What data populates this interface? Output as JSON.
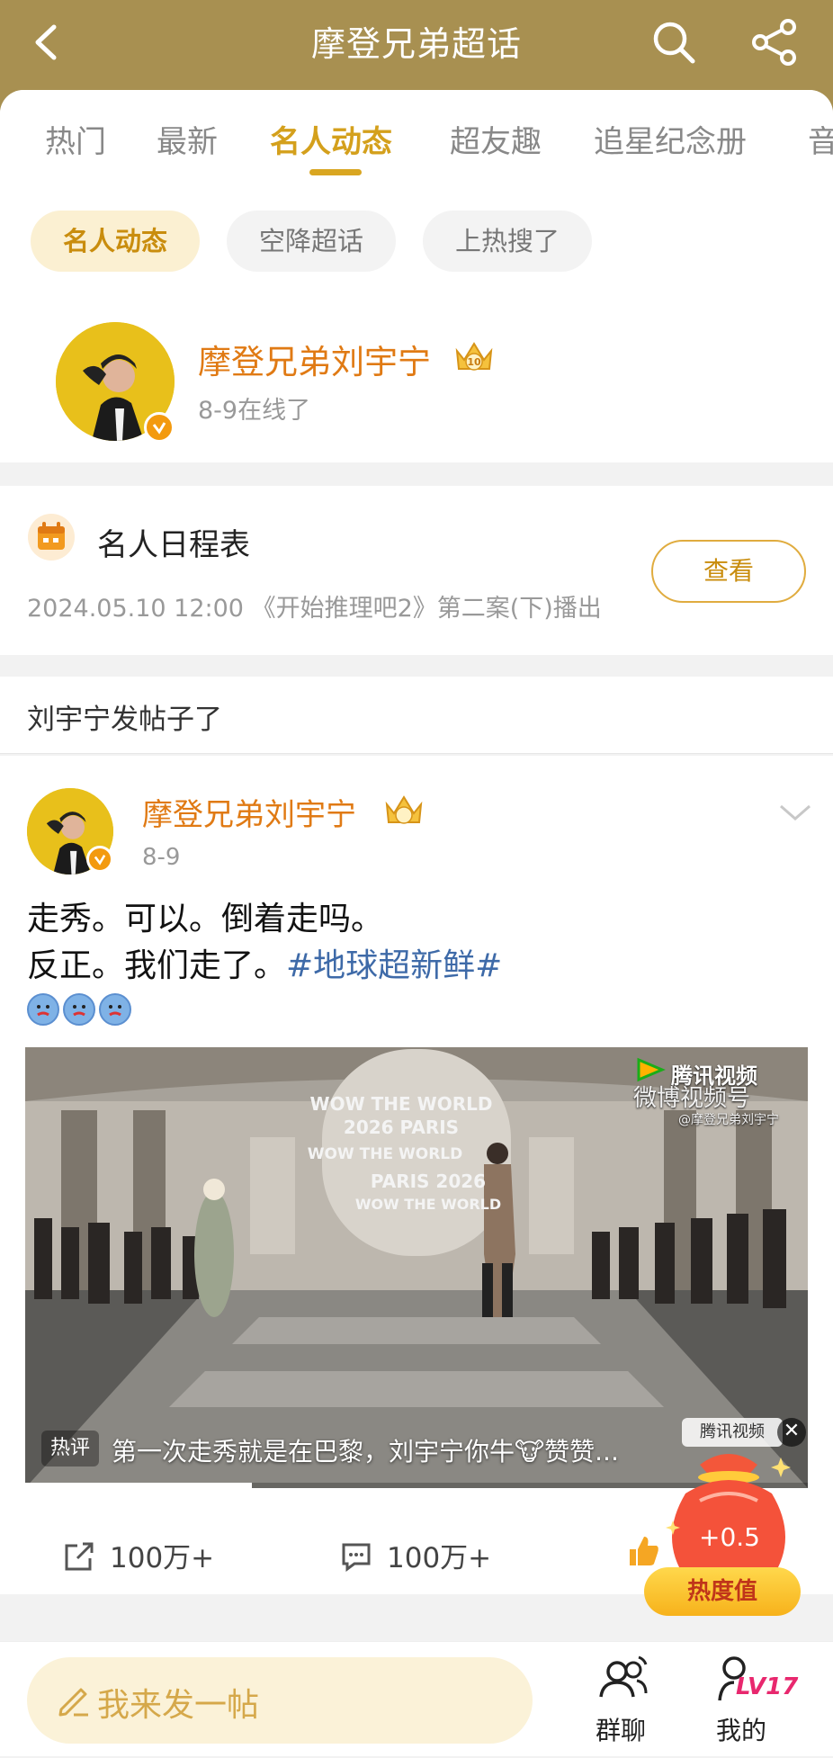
{
  "header": {
    "title": "摩登兄弟超话"
  },
  "tabs": [
    "热门",
    "最新",
    "名人动态",
    "超友趣",
    "追星纪念册",
    "音"
  ],
  "chips": [
    "名人动态",
    "空降超话",
    "上热搜了"
  ],
  "celebrity": {
    "name": "摩登兄弟刘宇宁",
    "crown_level": "10",
    "status": "8-9在线了"
  },
  "schedule": {
    "title": "名人日程表",
    "desc": "2024.05.10 12:00 《开始推理吧2》第二案(下)播出",
    "button": "查看"
  },
  "section": {
    "title": "刘宇宁发帖子了"
  },
  "post": {
    "author": "摩登兄弟刘宇宁",
    "time": "8-9",
    "text_line1": "走秀。可以。倒着走吗。",
    "text_line2_prefix": "反正。我们走了。",
    "hashtag": "#地球超新鲜#",
    "video": {
      "watermark_top": "腾讯视频",
      "watermark_weibo": "微博视频号",
      "watermark_user": "@摩登兄弟刘宇宁",
      "hot_tag": "热评",
      "hot_comment": "第一次走秀就是在巴黎，刘宇宁你牛🐮赞赞...",
      "bottom_logo": "腾讯视频",
      "backdrop_text_1": "WOW THE WORLD",
      "backdrop_text_2": "2026 PARIS",
      "backdrop_text_3": "WOW THE WORLD",
      "backdrop_text_4": "PARIS 2026",
      "backdrop_text_5": "WOW THE WORLD",
      "progress": 0.29
    },
    "repost_count": "100万+",
    "comment_count": "100万+"
  },
  "reward": {
    "value": "+0.5",
    "label": "热度值"
  },
  "bottom": {
    "compose": "我来发一帖",
    "group_chat": "群聊",
    "mine": "我的",
    "level": "LV17"
  },
  "colors": {
    "header_bg": "#a89051",
    "accent": "#d4a01c",
    "name_orange": "#e07a14",
    "hashtag": "#3e6aa8"
  }
}
